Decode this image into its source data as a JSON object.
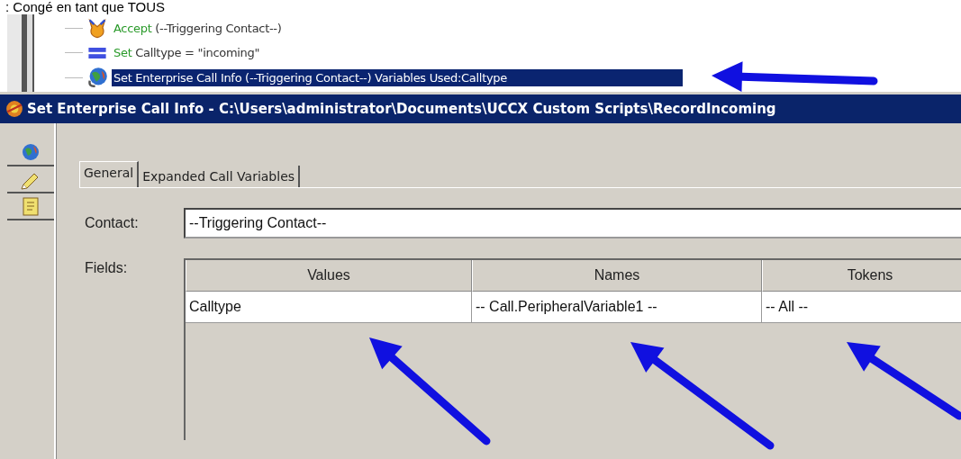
{
  "intro_text": ": Congé en tant que TOUS",
  "tree": {
    "items": [
      {
        "kind": "accept",
        "keyword": "Accept",
        "text": "(--Triggering Contact--)",
        "selected": false
      },
      {
        "kind": "set",
        "keyword": "Set",
        "text": "Calltype = \"incoming\"",
        "selected": false
      },
      {
        "kind": "enterprise",
        "text": "Set Enterprise Call Info (--Triggering Contact--) Variables Used:Calltype",
        "selected": true
      }
    ]
  },
  "dialog": {
    "title": "Set Enterprise Call Info - C:\\Users\\administrator\\Documents\\UCCX Custom Scripts\\RecordIncoming",
    "tabs": [
      {
        "label": "General",
        "selected": true
      },
      {
        "label": "Expanded Call Variables",
        "selected": false
      }
    ],
    "contact": {
      "label": "Contact:",
      "value": "--Triggering Contact--"
    },
    "fields": {
      "label": "Fields:",
      "columns": [
        "Values",
        "Names",
        "Tokens"
      ],
      "rows": [
        [
          "Calltype",
          "-- Call.PeripheralVariable1 --",
          "-- All --"
        ]
      ]
    }
  }
}
